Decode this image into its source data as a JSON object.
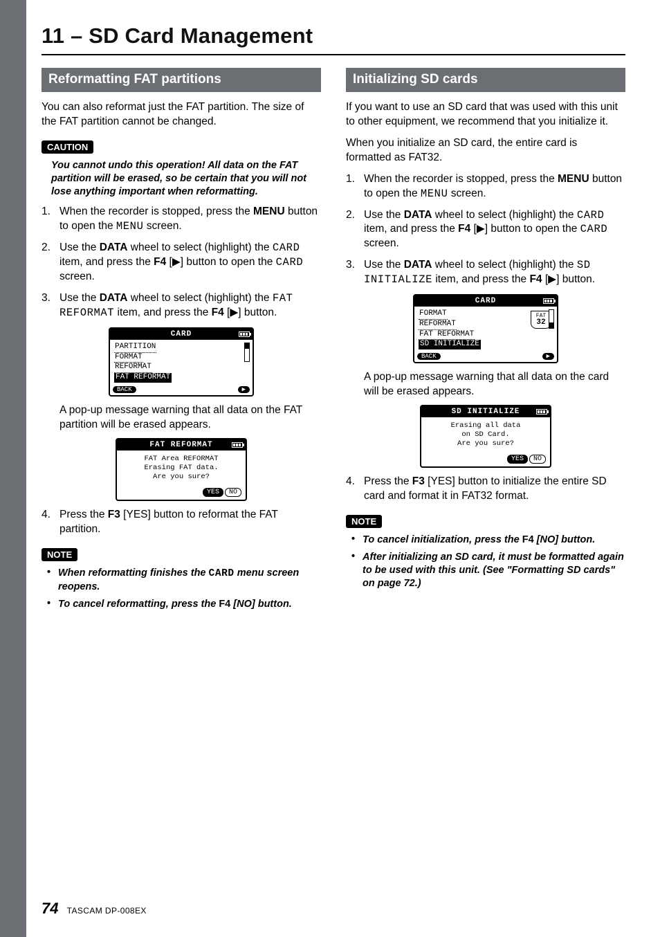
{
  "chapter": "11 – SD Card Management",
  "footer": {
    "page": "74",
    "model": "TASCAM  DP-008EX"
  },
  "left": {
    "heading": "Reformatting FAT partitions",
    "intro": "You can also reformat just the FAT partition. The size of the FAT partition cannot be changed.",
    "caution_label": "CAUTION",
    "caution_body": "You cannot undo this operation! All data on the FAT partition will be erased, so be certain that you will not lose anything important when reformatting.",
    "step1_a": "When the recorder is stopped, press the ",
    "step1_b": "MENU",
    "step1_c": " button to open the ",
    "step1_d": "MENU",
    "step1_e": " screen.",
    "step2_a": "Use the ",
    "step2_b": "DATA",
    "step2_c": " wheel to select (highlight) the ",
    "step2_d": "CARD",
    "step2_e": " item, and press the ",
    "step2_f": "F4",
    "step2_g": " [",
    "step2_h": "▶",
    "step2_i": "] button to open the ",
    "step2_j": "CARD",
    "step2_k": " screen.",
    "step3_a": "Use the ",
    "step3_b": "DATA",
    "step3_c": " wheel to select (highlight) the ",
    "step3_d": "FAT REFORMAT",
    "step3_e": " item, and press the ",
    "step3_f": "F4",
    "step3_g": " [",
    "step3_h": "▶",
    "step3_i": "] button.",
    "lcd1": {
      "title": "CARD",
      "items": [
        "PARTITION",
        "FORMAT",
        "REFORMAT"
      ],
      "sel": "FAT REFORMAT",
      "back": "BACK",
      "fwd": "▶"
    },
    "after1": "A pop-up message warning that all data on the FAT partition will be erased appears.",
    "lcd2": {
      "title": "FAT REFORMAT",
      "line1": "FAT Area REFORMAT",
      "line2": "Erasing FAT data.",
      "line3": "Are you sure?",
      "yes": "YES",
      "no": "NO"
    },
    "step4_a": "Press the ",
    "step4_b": "F3",
    "step4_c": " [YES] button to reformat the FAT partition.",
    "note_label": "NOTE",
    "note1_a": "When reformatting finishes the ",
    "note1_b": "CARD",
    "note1_c": " menu screen reopens.",
    "note2_a": "To cancel reformatting, press the ",
    "note2_b": "F4",
    "note2_c": " [NO] button."
  },
  "right": {
    "heading": "Initializing SD cards",
    "intro1": "If you want to use an SD card that was used with this unit to other equipment, we recommend that you initialize it.",
    "intro2": "When you initialize an SD card, the entire card is formatted as FAT32.",
    "step1_a": "When the recorder is stopped, press the ",
    "step1_b": "MENU",
    "step1_c": " button to open the ",
    "step1_d": "MENU",
    "step1_e": " screen.",
    "step2_a": "Use the ",
    "step2_b": "DATA",
    "step2_c": " wheel to select (highlight) the ",
    "step2_d": "CARD",
    "step2_e": " item, and press the ",
    "step2_f": "F4",
    "step2_g": " [",
    "step2_h": "▶",
    "step2_i": "] button to open the ",
    "step2_j": "CARD",
    "step2_k": " screen.",
    "step3_a": "Use the ",
    "step3_b": "DATA",
    "step3_c": " wheel to select (highlight) the ",
    "step3_d": "SD INITIALIZE",
    "step3_e": " item, and press the ",
    "step3_f": "F4",
    "step3_g": " [",
    "step3_h": "▶",
    "step3_i": "] button.",
    "lcd1": {
      "title": "CARD",
      "items": [
        "FORMAT",
        "REFORMAT",
        "FAT REFORMAT"
      ],
      "sel": "SD INITIALIZE",
      "back": "BACK",
      "fwd": "▶",
      "badge_top": "FAT",
      "badge_bot": "32"
    },
    "after1": "A pop-up message warning that all data on the card will be erased appears.",
    "lcd2": {
      "title": "SD INITIALIZE",
      "line1": "Erasing all data",
      "line2": "on SD Card.",
      "line3": "Are you sure?",
      "yes": "YES",
      "no": "NO"
    },
    "step4_a": "Press the ",
    "step4_b": "F3",
    "step4_c": " [YES] button to initialize the entire SD card and format it in FAT32 format.",
    "note_label": "NOTE",
    "note1_a": "To cancel initialization, press the ",
    "note1_b": "F4",
    "note1_c": " [NO] button.",
    "note2": "After initializing an SD card, it must be formatted again to be used with this unit. (See \"Formatting SD cards\" on page 72.)"
  }
}
